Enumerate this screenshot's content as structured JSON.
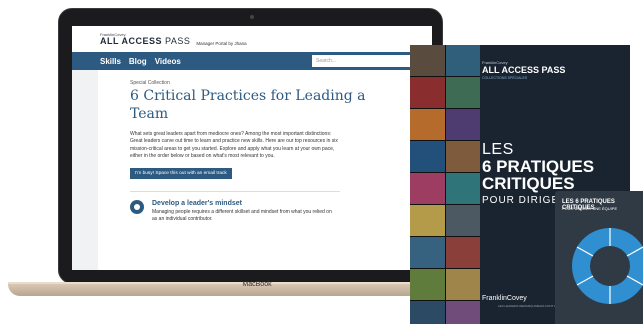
{
  "laptop": {
    "brand": "MacBook"
  },
  "site": {
    "logo_small": "FranklinCovey",
    "logo_main": "ALL ACCESS",
    "logo_pass": "PASS",
    "header_sub": "Manager Portal by Jhana"
  },
  "nav": {
    "items": [
      "Skills",
      "Blog",
      "Videos"
    ],
    "search_placeholder": "Search..."
  },
  "content": {
    "eyebrow": "Special Collection",
    "title": "6 Critical Practices for Leading a Team",
    "intro": "What sets great leaders apart from mediocre ones? Among the most important distinctions: Great leaders carve out time to learn and practice new skills. Here are our top resources in six mission-critical areas to get you started. Explore and apply what you learn at your own pace, either in the order below or based on what's most relevant to you.",
    "cta": "I'm busy! Space this out with an email track",
    "item_title": "Develop a leader's mindset",
    "item_text": "Managing people requires a different skillset and mindset from what you relied on as an individual contributor."
  },
  "book": {
    "logo_small": "FranklinCovey",
    "logo_main": "ALL ACCESS PASS",
    "logo_sub": "COLLECTIONS SPÉCIALES",
    "line1": "LES",
    "line2": "6 PRATIQUES CRITIQUES",
    "line3": "POUR DIRIGER U",
    "brand": "FranklinCovey",
    "brand_sub": "LES LEADERS REMARQUABLES FONT LA DIFFÉRENCE",
    "tile_colors": [
      "#5a4b3f",
      "#2f5f7a",
      "#8a2d2f",
      "#3e6b54",
      "#b46b2b",
      "#4e3c70",
      "#23507b",
      "#7d5b3c",
      "#9e3d62",
      "#2e7478",
      "#b49b4a",
      "#4d5962",
      "#37627f",
      "#8b3f3a",
      "#5f7c3c",
      "#a0854a",
      "#2c4a63",
      "#6f4c7a"
    ]
  },
  "poster": {
    "title": "LES 6 PRATIQUES CRITIQUES",
    "sub": "POUR DIRIGER UNE ÉQUIPE",
    "wheel_color": "#2f8fd1"
  }
}
